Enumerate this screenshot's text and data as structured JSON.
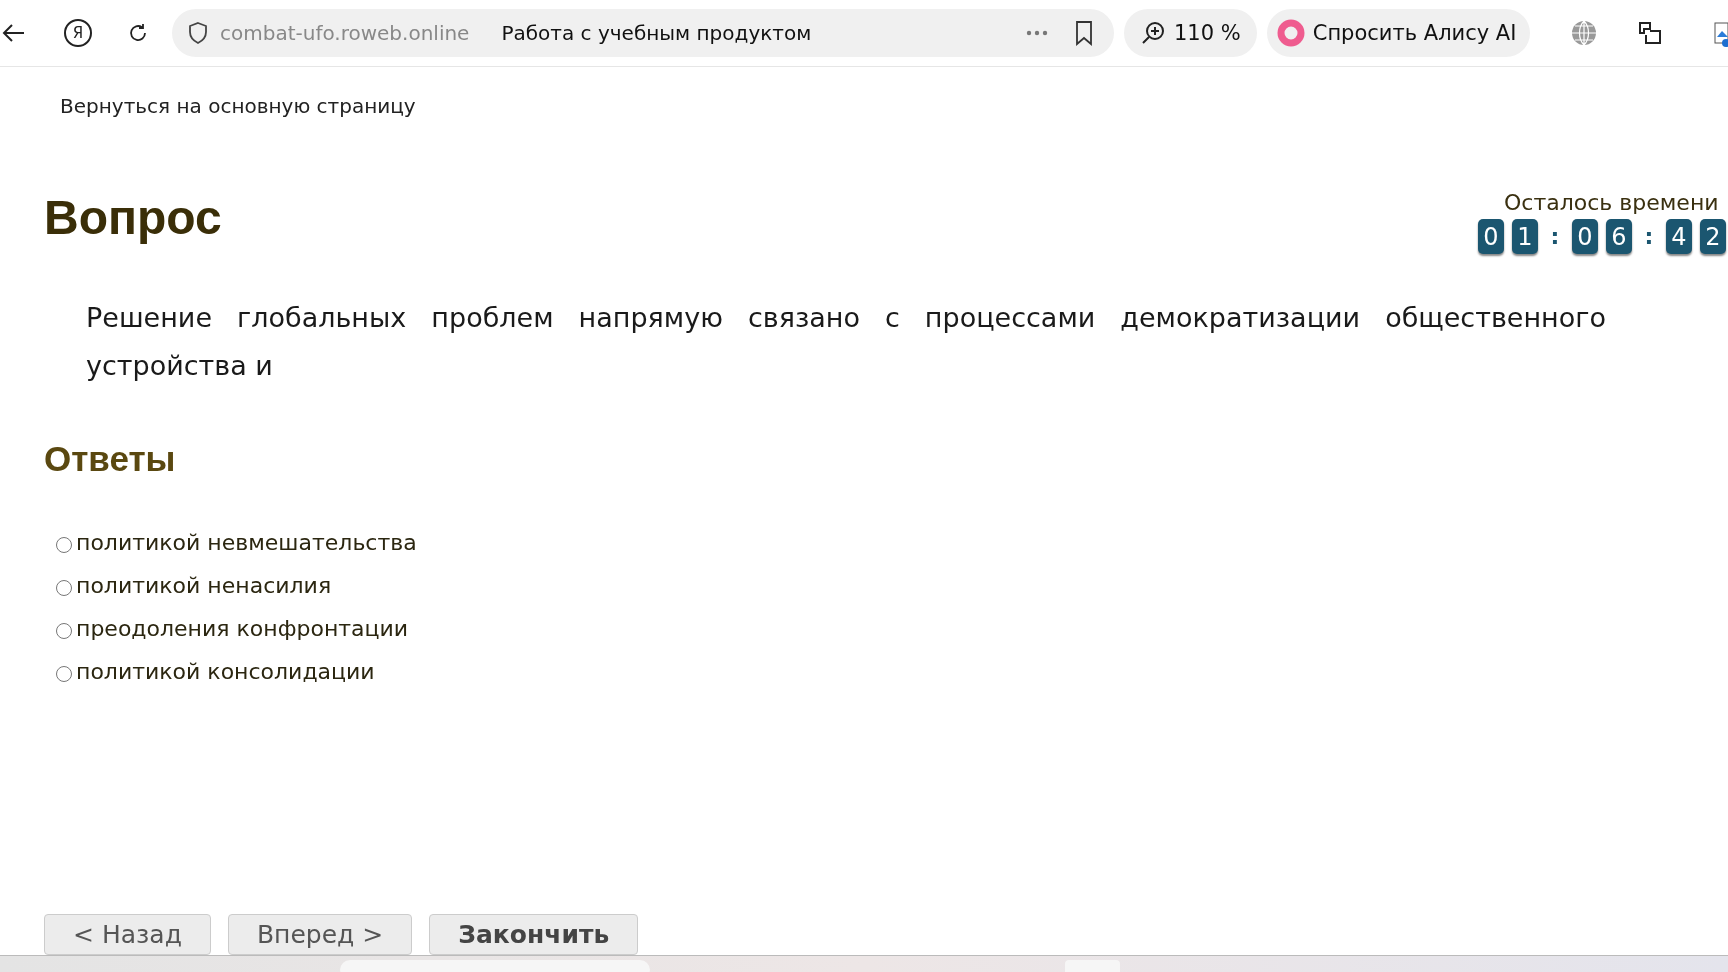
{
  "browser": {
    "logo": "Я",
    "url": "combat-ufo.roweb.online",
    "page_title": "Работа с учебным продуктом",
    "zoom": "110 %",
    "assistant": "Спросить Алису AI"
  },
  "header": {
    "back_link": "Вернуться на основную страницу"
  },
  "timer": {
    "label": "Осталось времени",
    "groups": [
      [
        "0",
        "1"
      ],
      [
        "0",
        "6"
      ],
      [
        "4",
        "2"
      ]
    ],
    "separators": [
      ":",
      ":"
    ]
  },
  "question": {
    "heading": "Вопрос",
    "text": "Решение глобальных проблем напрямую связано с процессами демократизации общественного устройства и"
  },
  "answers": {
    "heading": "Ответы",
    "options": [
      {
        "label": "политикой невмешательства",
        "selected": false
      },
      {
        "label": "политикой ненасилия",
        "selected": false
      },
      {
        "label": "преодоления конфронтации",
        "selected": false
      },
      {
        "label": "политикой консолидации",
        "selected": false
      }
    ]
  },
  "buttons": [
    {
      "label": "< Назад",
      "kind": "plain"
    },
    {
      "label": "Вперед >",
      "kind": "plain"
    },
    {
      "label": "Закончить",
      "kind": "primary"
    }
  ]
}
